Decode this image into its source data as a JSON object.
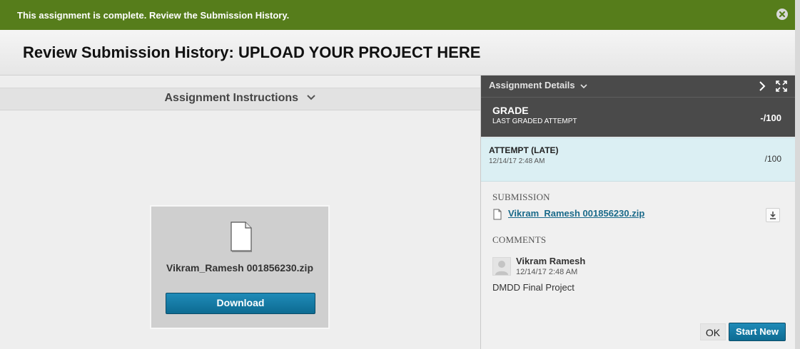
{
  "banner": {
    "message": "This assignment is complete. Review the Submission History.",
    "close_icon": "close-circle-icon",
    "color": "#567d1b"
  },
  "header": {
    "title": "Review Submission History: UPLOAD YOUR PROJECT HERE"
  },
  "left_panel": {
    "instructions_label": "Assignment Instructions",
    "file_card": {
      "file_name": "Vikram_Ramesh 001856230.zip",
      "download_label": "Download"
    }
  },
  "right_panel": {
    "details_label": "Assignment Details",
    "grade": {
      "label": "GRADE",
      "sub_label": "LAST GRADED ATTEMPT",
      "score": "-/100"
    },
    "attempt": {
      "label": "ATTEMPT (LATE)",
      "date": "12/14/17 2:48 AM",
      "score": "/100"
    },
    "submission": {
      "section_label": "SUBMISSION",
      "file_name": "Vikram_Ramesh 001856230.zip"
    },
    "comments": {
      "section_label": "COMMENTS",
      "author": "Vikram Ramesh",
      "date": "12/14/17 2:48 AM",
      "text": "DMDD Final Project"
    },
    "buttons": {
      "ok_label": "OK",
      "start_new_label": "Start New"
    }
  },
  "colors": {
    "accent": "#0d6b92",
    "link": "#1a6a8a",
    "dark_panel": "#4a4a4a",
    "attempt_bg": "#dbeff3"
  }
}
